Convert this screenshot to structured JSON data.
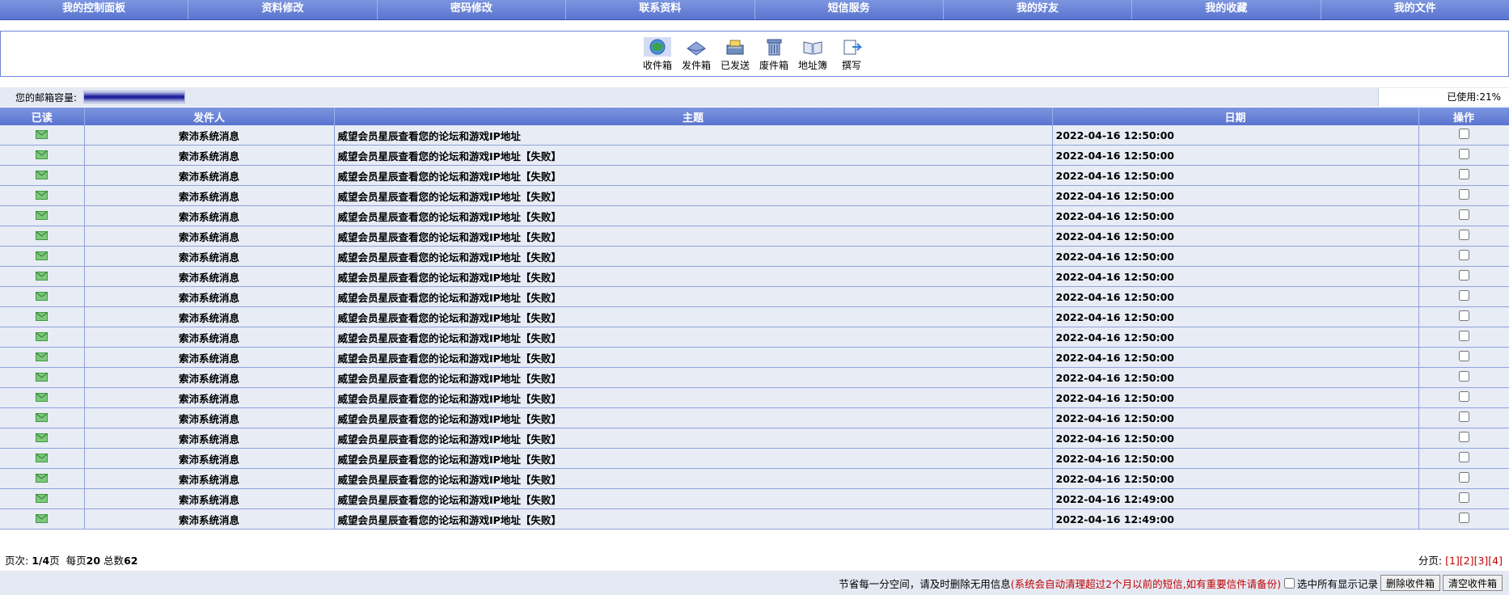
{
  "nav": [
    "我的控制面板",
    "资料修改",
    "密码修改",
    "联系资料",
    "短信服务",
    "我的好友",
    "我的收藏",
    "我的文件"
  ],
  "toolbar": {
    "inbox": "收件箱",
    "outbox": "发件箱",
    "sent": "已发送",
    "trash": "废件箱",
    "addressbook": "地址簿",
    "compose": "撰写"
  },
  "capacity": {
    "label": "您的邮箱容量:",
    "used": "已使用:21%",
    "used_fraction": 0.21
  },
  "table": {
    "headers": {
      "read": "已读",
      "sender": "发件人",
      "subject": "主题",
      "date": "日期",
      "op": "操作"
    },
    "rows": [
      {
        "sender": "索沛系统消息",
        "subject": "威望会员星辰查看您的论坛和游戏IP地址",
        "date": "2022-04-16 12:50:00"
      },
      {
        "sender": "索沛系统消息",
        "subject": "威望会员星辰查看您的论坛和游戏IP地址【失败】",
        "date": "2022-04-16 12:50:00"
      },
      {
        "sender": "索沛系统消息",
        "subject": "威望会员星辰查看您的论坛和游戏IP地址【失败】",
        "date": "2022-04-16 12:50:00"
      },
      {
        "sender": "索沛系统消息",
        "subject": "威望会员星辰查看您的论坛和游戏IP地址【失败】",
        "date": "2022-04-16 12:50:00"
      },
      {
        "sender": "索沛系统消息",
        "subject": "威望会员星辰查看您的论坛和游戏IP地址【失败】",
        "date": "2022-04-16 12:50:00"
      },
      {
        "sender": "索沛系统消息",
        "subject": "威望会员星辰查看您的论坛和游戏IP地址【失败】",
        "date": "2022-04-16 12:50:00"
      },
      {
        "sender": "索沛系统消息",
        "subject": "威望会员星辰查看您的论坛和游戏IP地址【失败】",
        "date": "2022-04-16 12:50:00"
      },
      {
        "sender": "索沛系统消息",
        "subject": "威望会员星辰查看您的论坛和游戏IP地址【失败】",
        "date": "2022-04-16 12:50:00"
      },
      {
        "sender": "索沛系统消息",
        "subject": "威望会员星辰查看您的论坛和游戏IP地址【失败】",
        "date": "2022-04-16 12:50:00"
      },
      {
        "sender": "索沛系统消息",
        "subject": "威望会员星辰查看您的论坛和游戏IP地址【失败】",
        "date": "2022-04-16 12:50:00"
      },
      {
        "sender": "索沛系统消息",
        "subject": "威望会员星辰查看您的论坛和游戏IP地址【失败】",
        "date": "2022-04-16 12:50:00"
      },
      {
        "sender": "索沛系统消息",
        "subject": "威望会员星辰查看您的论坛和游戏IP地址【失败】",
        "date": "2022-04-16 12:50:00"
      },
      {
        "sender": "索沛系统消息",
        "subject": "威望会员星辰查看您的论坛和游戏IP地址【失败】",
        "date": "2022-04-16 12:50:00"
      },
      {
        "sender": "索沛系统消息",
        "subject": "威望会员星辰查看您的论坛和游戏IP地址【失败】",
        "date": "2022-04-16 12:50:00"
      },
      {
        "sender": "索沛系统消息",
        "subject": "威望会员星辰查看您的论坛和游戏IP地址【失败】",
        "date": "2022-04-16 12:50:00"
      },
      {
        "sender": "索沛系统消息",
        "subject": "威望会员星辰查看您的论坛和游戏IP地址【失败】",
        "date": "2022-04-16 12:50:00"
      },
      {
        "sender": "索沛系统消息",
        "subject": "威望会员星辰查看您的论坛和游戏IP地址【失败】",
        "date": "2022-04-16 12:50:00"
      },
      {
        "sender": "索沛系统消息",
        "subject": "威望会员星辰查看您的论坛和游戏IP地址【失败】",
        "date": "2022-04-16 12:50:00"
      },
      {
        "sender": "索沛系统消息",
        "subject": "威望会员星辰查看您的论坛和游戏IP地址【失败】",
        "date": "2022-04-16 12:49:00"
      },
      {
        "sender": "索沛系统消息",
        "subject": "威望会员星辰查看您的论坛和游戏IP地址【失败】",
        "date": "2022-04-16 12:49:00"
      }
    ]
  },
  "pager": {
    "prefix": "页次:",
    "current": "1/4",
    "unit": "页",
    "per_page_label": "每页",
    "per_page": "20",
    "total_label": "总数",
    "total": "62",
    "pages_label": "分页:",
    "pages": [
      "[1]",
      "[2]",
      "[3]",
      "[4]"
    ]
  },
  "actions": {
    "tip": "节省每一分空间，请及时删除无用信息",
    "warning": "(系统会自动清理超过2个月以前的短信,如有重要信件请备份)",
    "select_all": "选中所有显示记录",
    "delete_button": "删除收件箱",
    "clear_button": "清空收件箱"
  },
  "colors": {
    "header_blue": "#5a74cf",
    "row_bg": "#e8ecf5",
    "warn_red": "#c00000",
    "mail_icon_green": "#3f9a3f"
  }
}
